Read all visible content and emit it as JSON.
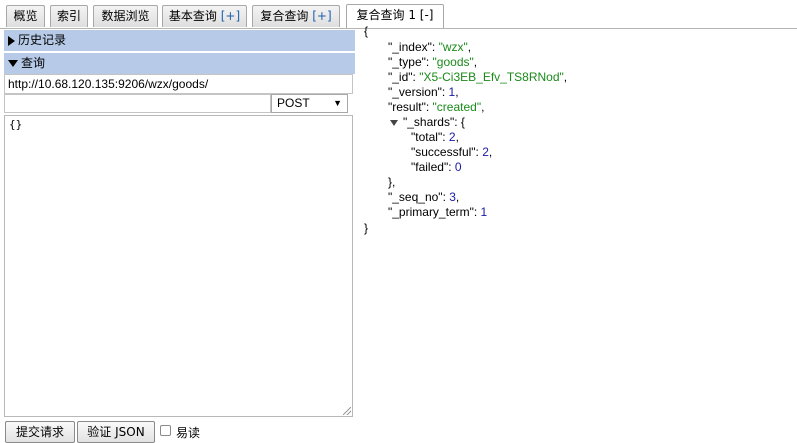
{
  "tabs": [
    {
      "label": "概览"
    },
    {
      "label": "索引"
    },
    {
      "label": "数据浏览"
    },
    {
      "label": "基本查询",
      "suffix": "[+]"
    },
    {
      "label": "复合查询",
      "suffix": "[+]"
    },
    {
      "label": "复合查询 1 [-]"
    }
  ],
  "left": {
    "history_label": "历史记录",
    "query_label": "查询",
    "url": "http://10.68.120.135:9206/wzx/goods/",
    "path": "",
    "method": "POST",
    "method_arrow": "▼",
    "body": "{}",
    "submit_label": "提交请求",
    "validate_label": "验证 JSON",
    "readable_label": "易读",
    "readable_checked": false
  },
  "response": {
    "open_brace": "{",
    "close_brace": "}",
    "lines": [
      {
        "key": "\"_index\"",
        "value": "\"wzx\"",
        "type": "string"
      },
      {
        "key": "\"_type\"",
        "value": "\"goods\"",
        "type": "string"
      },
      {
        "key": "\"_id\"",
        "value": "\"X5-Ci3EB_Efv_TS8RNod\"",
        "type": "string"
      },
      {
        "key": "\"_version\"",
        "value": "1",
        "type": "number"
      },
      {
        "key": "\"result\"",
        "value": "\"created\"",
        "type": "string"
      },
      {
        "key": "\"_shards\"",
        "value": "{",
        "type": "object"
      },
      {
        "key": "\"total\"",
        "value": "2",
        "type": "number"
      },
      {
        "key": "\"successful\"",
        "value": "2",
        "type": "number"
      },
      {
        "key": "\"failed\"",
        "value": "0",
        "type": "number"
      },
      {
        "key": "",
        "value": "},",
        "type": "close"
      },
      {
        "key": "\"_seq_no\"",
        "value": "3",
        "type": "number"
      },
      {
        "key": "\"_primary_term\"",
        "value": "1",
        "type": "number"
      }
    ]
  },
  "colors": {
    "string": "#1a8a1a",
    "number": "#1a1aa6",
    "section_header": "#b7cbe8"
  }
}
